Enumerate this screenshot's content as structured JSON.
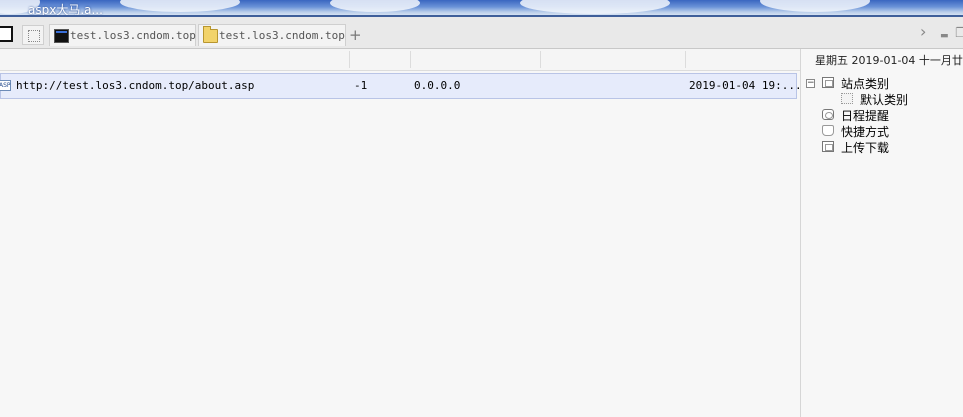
{
  "window": {
    "title": "aspx大马.a..."
  },
  "tabs": [
    {
      "label": "test.los3.cndom.top",
      "icon": "terminal-icon"
    },
    {
      "label": "test.los3.cndom.top",
      "icon": "folder-icon"
    }
  ],
  "tabbar": {
    "new_tab": "+",
    "scroll_right": "›",
    "minimize": "▬",
    "restore": "❐"
  },
  "list": {
    "rows": [
      {
        "icon": "asp-file-icon",
        "icon_text": "ASP",
        "url": "http://test.los3.cndom.top/about.asp",
        "code": "-1",
        "ip": "0.0.0.0",
        "date": "2019-01-04 19:..."
      }
    ]
  },
  "right_panel": {
    "date_text": "星期五 2019-01-04 十一月廿",
    "tree": [
      {
        "label": "站点类别",
        "icon": "category-icon",
        "expanded": true,
        "toggle": "−"
      },
      {
        "label": "默认类别",
        "icon": "default-category-icon"
      },
      {
        "label": "日程提醒",
        "icon": "schedule-icon"
      },
      {
        "label": "快捷方式",
        "icon": "shortcut-icon"
      },
      {
        "label": "上传下载",
        "icon": "upload-download-icon"
      }
    ]
  },
  "colors": {
    "row_highlight": "#e6ebfb",
    "row_border": "#b9c4e6",
    "background": "#f7f7f7"
  }
}
